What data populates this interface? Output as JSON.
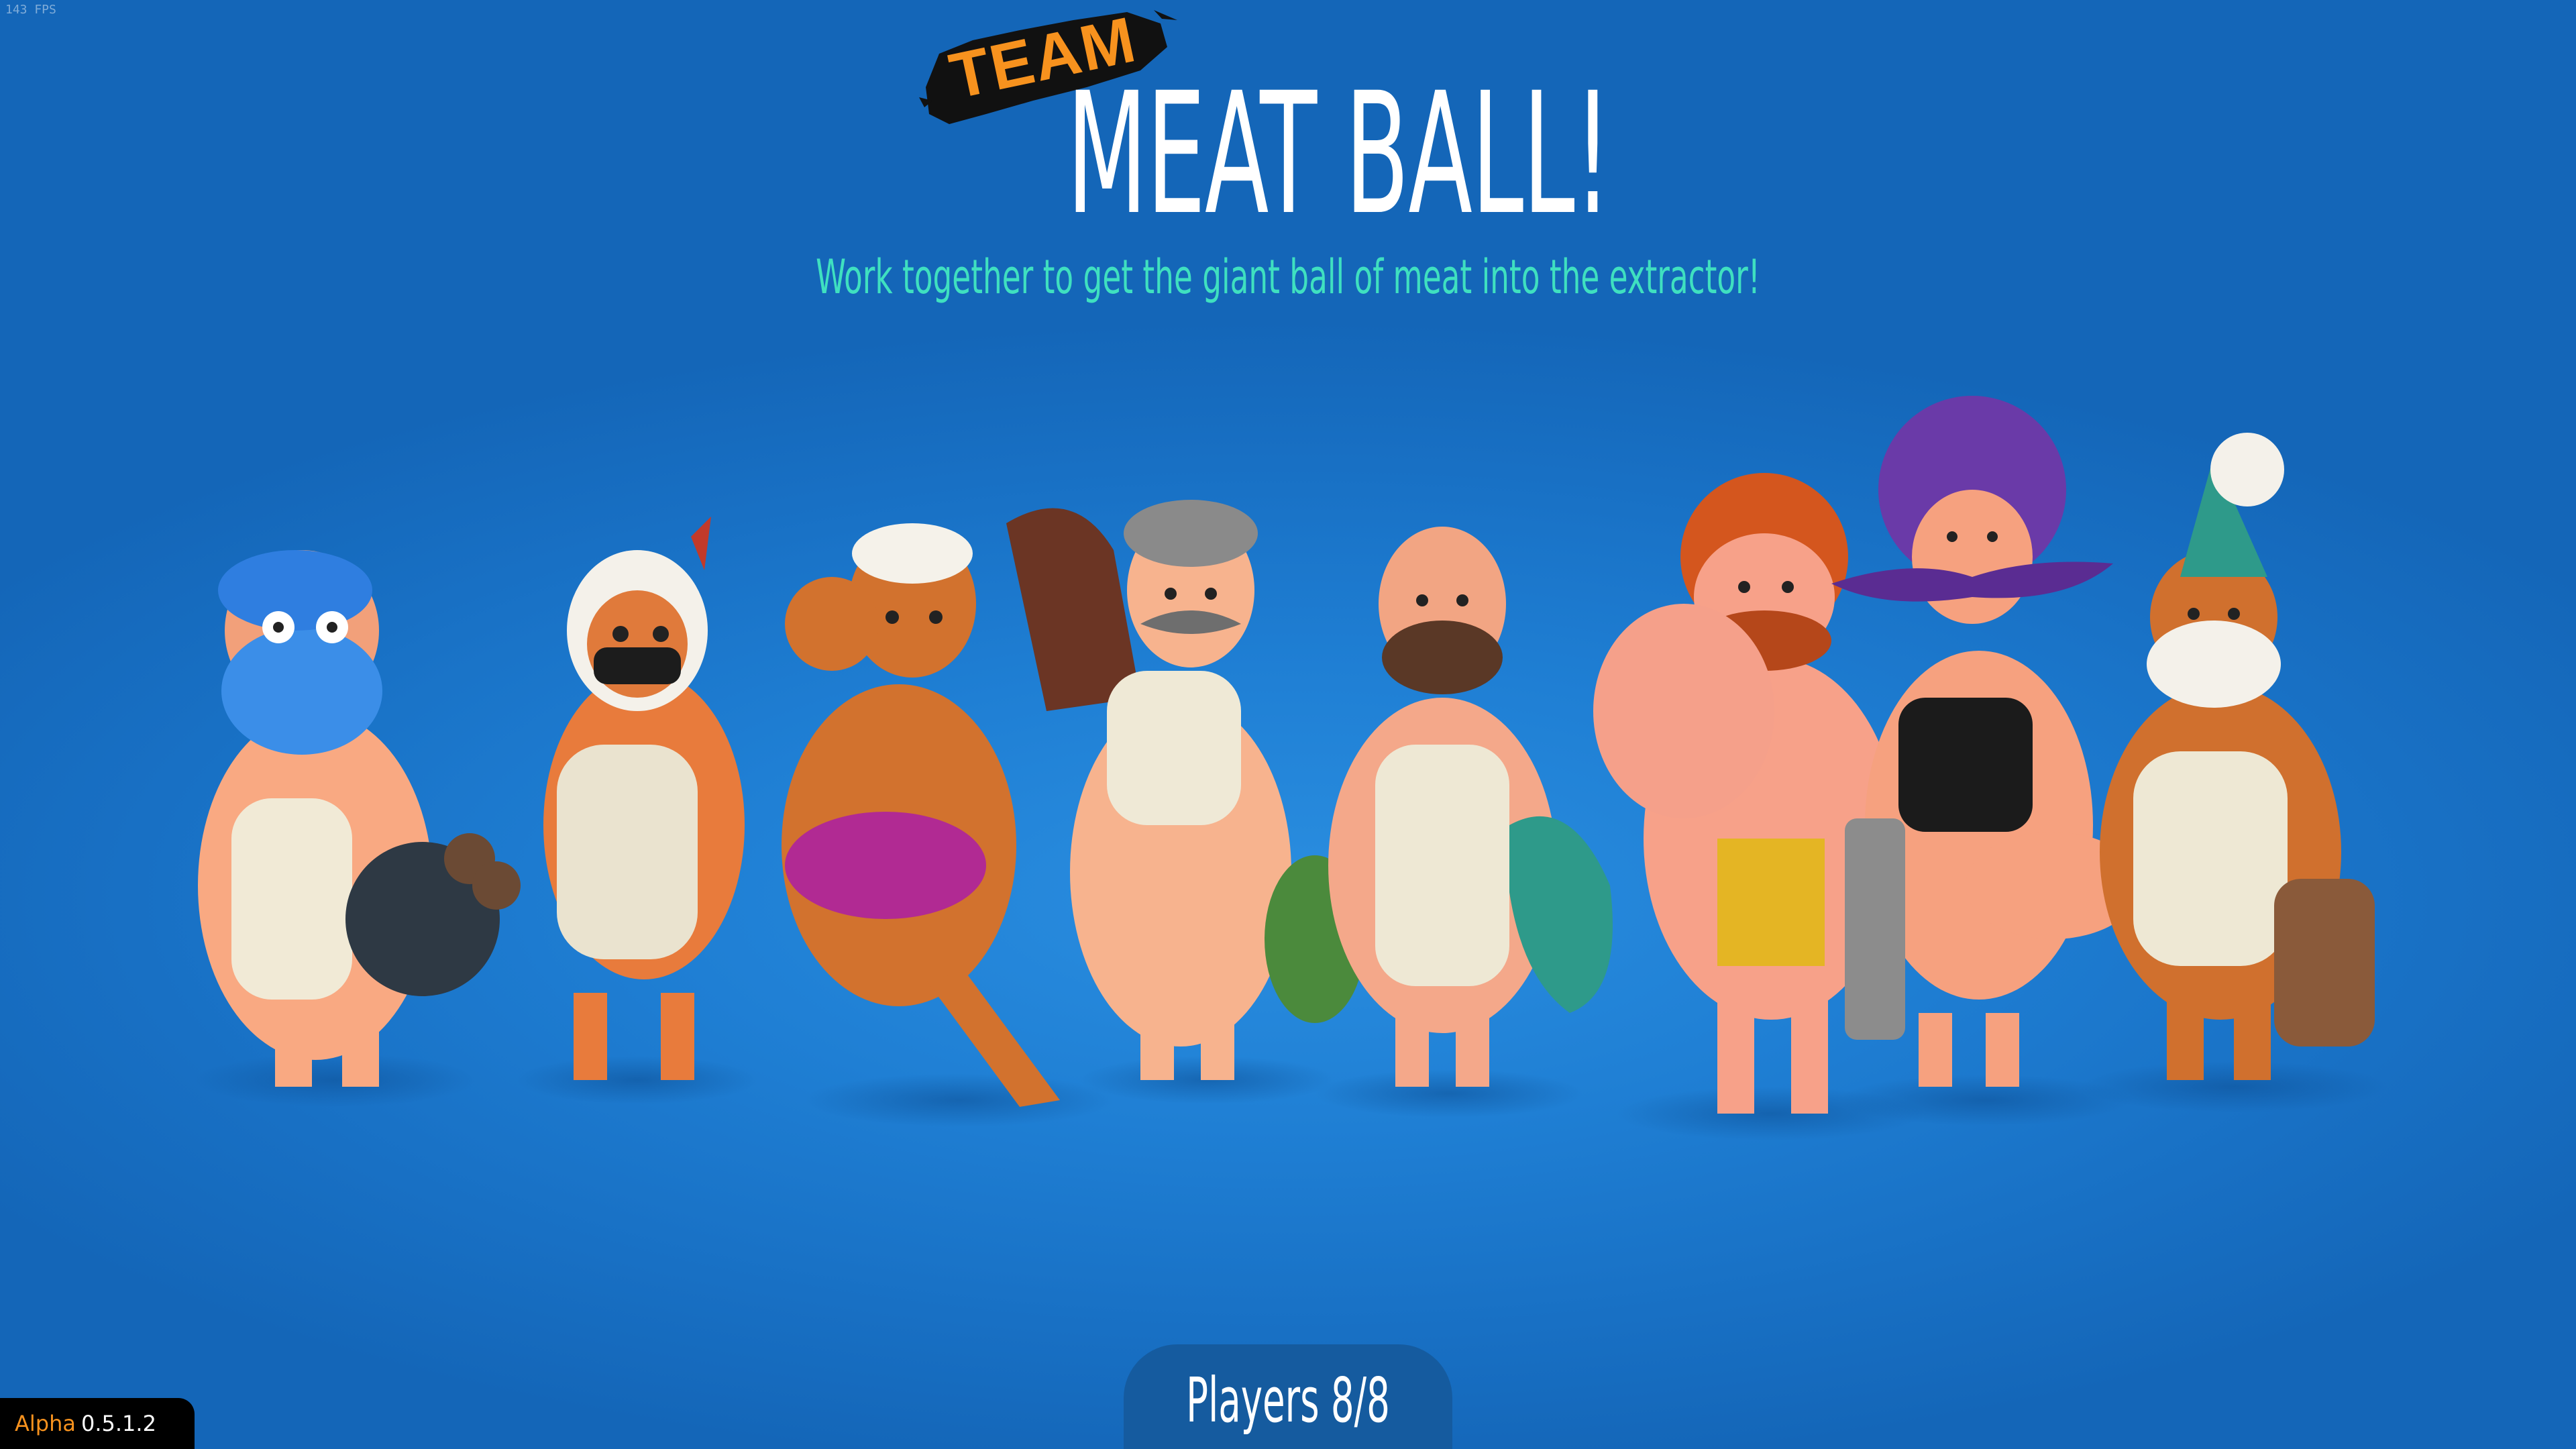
{
  "hud": {
    "fps": "143 FPS"
  },
  "title": {
    "team_label": "TEAM",
    "game_mode": "MEAT BALL!",
    "description": "Work together to get the giant ball of meat into the extractor!"
  },
  "lobby": {
    "players_label": "Players 8/8",
    "players_current": 8,
    "players_max": 8
  },
  "build": {
    "channel": "Alpha",
    "version": "0.5.1.2"
  },
  "characters": [
    {
      "name": "blue-bearded-butcher"
    },
    {
      "name": "white-haired-masked-butcher"
    },
    {
      "name": "flexing-strongman-butcher"
    },
    {
      "name": "grey-haired-mustache-butcher"
    },
    {
      "name": "bald-bearded-butcher"
    },
    {
      "name": "red-haired-waving-butcher"
    },
    {
      "name": "purple-afro-mustache-butcher"
    },
    {
      "name": "chef-hat-white-beard-butcher"
    }
  ],
  "colors": {
    "background": "#1f7fd4",
    "accent_orange": "#f7921e",
    "subtitle_teal": "#3fe0c0",
    "tab_dark_blue": "#155b9f"
  }
}
